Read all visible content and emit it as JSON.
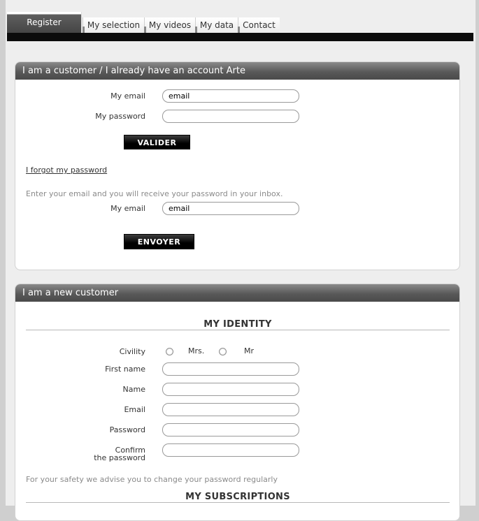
{
  "tabs": [
    {
      "label": "Register",
      "active": true
    },
    {
      "label": "My selection"
    },
    {
      "label": "My videos"
    },
    {
      "label": "My data"
    },
    {
      "label": "Contact"
    }
  ],
  "existing": {
    "heading": "I am a customer / I already have an account Arte",
    "email_label": "My email",
    "email_value": "email",
    "password_label": "My password",
    "password_value": "",
    "submit_label": "VALIDER",
    "forgot_link": "I forgot my password",
    "forgot_hint": "Enter your email and you will receive your password in your inbox.",
    "forgot_email_label": "My email",
    "forgot_email_value": "email",
    "send_label": "ENVOYER"
  },
  "newcustomer": {
    "heading": "I am a new customer",
    "identity_title": "MY IDENTITY",
    "civility_label": "Civility",
    "civility_options": [
      "Mrs.",
      "Mr"
    ],
    "firstname_label": "First name",
    "name_label": "Name",
    "email_label": "Email",
    "password_label": "Password",
    "confirm_label_1": "Confirm",
    "confirm_label_2": "the password",
    "safety_hint": "For your safety we advise you to change your password regularly",
    "subscriptions_title": "MY SUBSCRIPTIONS"
  }
}
